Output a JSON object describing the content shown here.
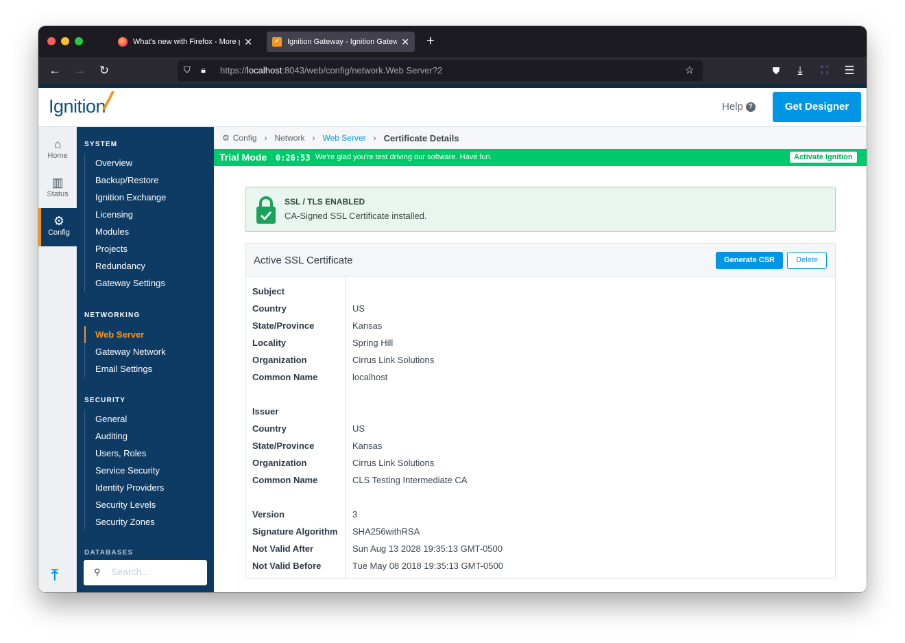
{
  "browser": {
    "tabs": [
      {
        "label": "What's new with Firefox - More p",
        "active": false
      },
      {
        "label": "Ignition Gateway - Ignition Gatew",
        "active": true
      }
    ],
    "url_prefix": "https://",
    "url_host": "localhost",
    "url_rest": ":8043/web/config/network.Web Server?2"
  },
  "header": {
    "logo": "Ignition",
    "help_label": "Help",
    "get_designer_label": "Get Designer"
  },
  "rail": [
    {
      "label": "Home",
      "icon": "home-icon"
    },
    {
      "label": "Status",
      "icon": "bar-chart-icon"
    },
    {
      "label": "Config",
      "icon": "gear-icon",
      "active": true
    }
  ],
  "nav": {
    "system": {
      "title": "SYSTEM",
      "items": [
        "Overview",
        "Backup/Restore",
        "Ignition Exchange",
        "Licensing",
        "Modules",
        "Projects",
        "Redundancy",
        "Gateway Settings"
      ]
    },
    "networking": {
      "title": "NETWORKING",
      "items": [
        "Web Server",
        "Gateway Network",
        "Email Settings"
      ],
      "active": "Web Server"
    },
    "security": {
      "title": "SECURITY",
      "items": [
        "General",
        "Auditing",
        "Users, Roles",
        "Service Security",
        "Identity Providers",
        "Security Levels",
        "Security Zones"
      ]
    },
    "databases": {
      "title": "DATABASES"
    },
    "search_placeholder": "Search..."
  },
  "breadcrumb": {
    "config": "Config",
    "network": "Network",
    "web_server": "Web Server",
    "current": "Certificate Details"
  },
  "trial": {
    "label": "Trial Mode",
    "timer": "0:26:53",
    "message": "We're glad you're test driving our software. Have fun.",
    "activate_label": "Activate Ignition"
  },
  "alert": {
    "title": "SSL / TLS ENABLED",
    "message": "CA-Signed SSL Certificate installed."
  },
  "panel": {
    "title": "Active SSL Certificate",
    "generate_csr_label": "Generate CSR",
    "delete_label": "Delete",
    "rows": [
      {
        "k": "Subject",
        "v": ""
      },
      {
        "k": "Country",
        "v": "US"
      },
      {
        "k": "State/Province",
        "v": "Kansas"
      },
      {
        "k": "Locality",
        "v": "Spring Hill"
      },
      {
        "k": "Organization",
        "v": "Cirrus Link Solutions"
      },
      {
        "k": "Common Name",
        "v": "localhost"
      },
      {
        "k": "",
        "v": ""
      },
      {
        "k": "Issuer",
        "v": ""
      },
      {
        "k": "Country",
        "v": "US"
      },
      {
        "k": "State/Province",
        "v": "Kansas"
      },
      {
        "k": "Organization",
        "v": "Cirrus Link Solutions"
      },
      {
        "k": "Common Name",
        "v": "CLS Testing Intermediate CA"
      },
      {
        "k": "",
        "v": ""
      },
      {
        "k": "Version",
        "v": "3"
      },
      {
        "k": "Signature Algorithm",
        "v": "SHA256withRSA"
      },
      {
        "k": "Not Valid After",
        "v": "Sun Aug 13 2028 19:35:13 GMT-0500"
      },
      {
        "k": "Not Valid Before",
        "v": "Tue May 08 2018 19:35:13 GMT-0500"
      }
    ]
  },
  "colors": {
    "brand_blue": "#0096e6",
    "nav_bg": "#0d3b64",
    "accent_orange": "#f7941d",
    "trial_green": "#00c96b"
  }
}
